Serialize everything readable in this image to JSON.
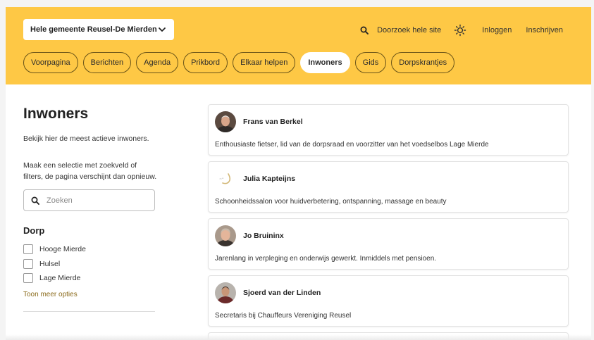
{
  "header": {
    "location_select": "Hele gemeente Reusel-De Mierden",
    "search_link": "Doorzoek hele site",
    "login": "Inloggen",
    "signup": "Inschrijven",
    "background_color": "#fec845"
  },
  "nav": {
    "tabs": [
      {
        "label": "Voorpagina",
        "active": false
      },
      {
        "label": "Berichten",
        "active": false
      },
      {
        "label": "Agenda",
        "active": false
      },
      {
        "label": "Prikbord",
        "active": false
      },
      {
        "label": "Elkaar helpen",
        "active": false
      },
      {
        "label": "Inwoners",
        "active": true
      },
      {
        "label": "Gids",
        "active": false
      },
      {
        "label": "Dorpskrantjes",
        "active": false
      }
    ]
  },
  "sidebar": {
    "title": "Inwoners",
    "intro": "Bekijk hier de meest actieve inwoners.",
    "hint": "Maak een selectie met zoekveld of filters, de pagina verschijnt dan opnieuw.",
    "search_placeholder": "Zoeken",
    "filter_title": "Dorp",
    "villages": [
      "Hooge Mierde",
      "Hulsel",
      "Lage Mierde"
    ],
    "more_options": "Toon meer opties"
  },
  "residents": [
    {
      "name": "Frans van Berkel",
      "bio": "Enthousiaste fietser, lid van de dorpsraad en voorzitter van het voedselbos Lage Mierde",
      "avatar": "photo"
    },
    {
      "name": "Julia Kapteijns",
      "bio": "Schoonheidssalon voor huidverbetering, ontspanning, massage en beauty",
      "avatar": "logo"
    },
    {
      "name": "Jo Bruininx",
      "bio": "Jarenlang in verpleging en onderwijs gewerkt. Inmiddels met pensioen.",
      "avatar": "photo"
    },
    {
      "name": "Sjoerd van der Linden",
      "bio": "Secretaris bij Chauffeurs Vereniging Reusel",
      "avatar": "photo"
    }
  ]
}
